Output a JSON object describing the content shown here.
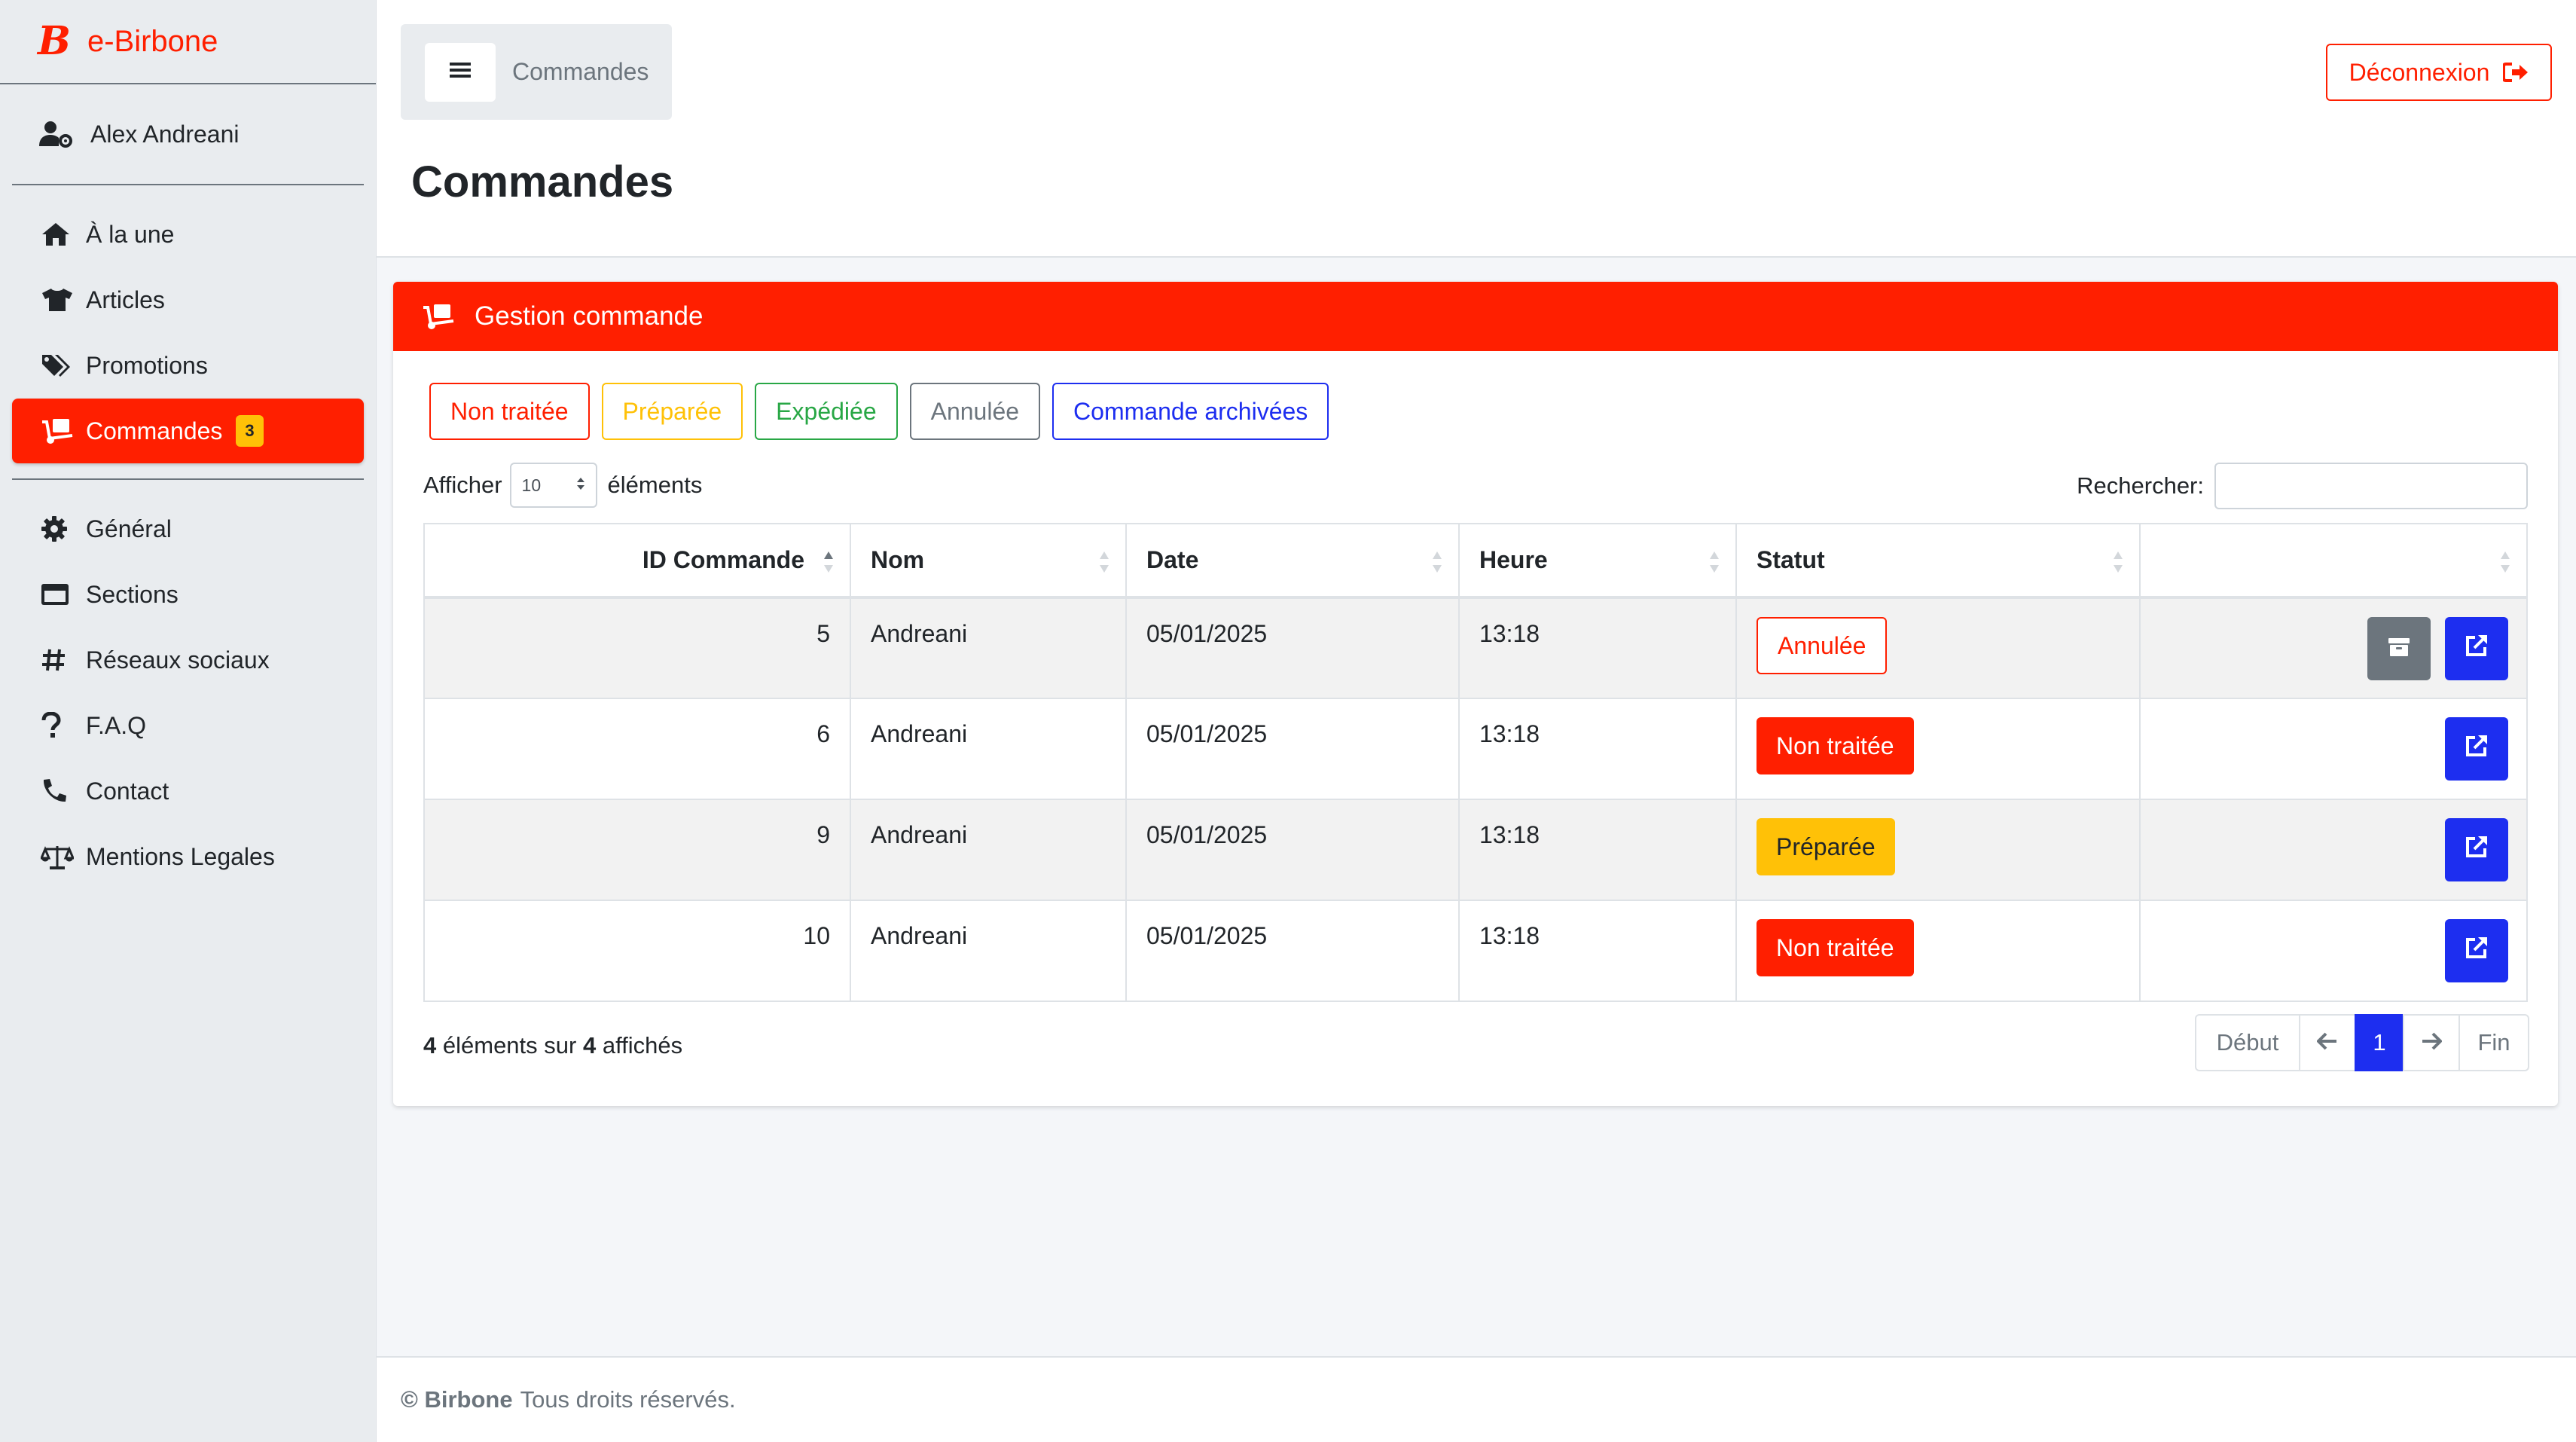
{
  "brand": {
    "logo_letter": "B",
    "name": "e-Birbone"
  },
  "user": {
    "name": "Alex Andreani"
  },
  "sidebar": {
    "items": [
      {
        "label": "À la une",
        "icon": "home-icon"
      },
      {
        "label": "Articles",
        "icon": "tshirt-icon"
      },
      {
        "label": "Promotions",
        "icon": "tags-icon"
      },
      {
        "label": "Commandes",
        "icon": "dolly-icon",
        "badge": "3",
        "active": true
      }
    ],
    "items2": [
      {
        "label": "Général",
        "icon": "gear-icon"
      },
      {
        "label": "Sections",
        "icon": "window-icon"
      },
      {
        "label": "Réseaux sociaux",
        "icon": "hashtag-icon"
      },
      {
        "label": "F.A.Q",
        "icon": "question-icon"
      },
      {
        "label": "Contact",
        "icon": "phone-icon"
      },
      {
        "label": "Mentions Legales",
        "icon": "scale-icon"
      }
    ]
  },
  "header": {
    "breadcrumb": "Commandes",
    "logout_label": "Déconnexion",
    "page_title": "Commandes"
  },
  "card": {
    "title": "Gestion commande",
    "filters": [
      "Non traitée",
      "Préparée",
      "Expédiée",
      "Annulée",
      "Commande archivées"
    ],
    "length_prefix": "Afficher",
    "length_value": "10",
    "length_suffix": "éléments",
    "search_label": "Rechercher:",
    "search_value": ""
  },
  "table": {
    "columns": [
      "ID Commande",
      "Nom",
      "Date",
      "Heure",
      "Statut",
      ""
    ],
    "rows": [
      {
        "id": "5",
        "nom": "Andreani",
        "date": "05/01/2025",
        "heure": "13:18",
        "statut": "Annulée",
        "style": "outline-red",
        "archive": true
      },
      {
        "id": "6",
        "nom": "Andreani",
        "date": "05/01/2025",
        "heure": "13:18",
        "statut": "Non traitée",
        "style": "red",
        "archive": false
      },
      {
        "id": "9",
        "nom": "Andreani",
        "date": "05/01/2025",
        "heure": "13:18",
        "statut": "Préparée",
        "style": "yellow",
        "archive": false
      },
      {
        "id": "10",
        "nom": "Andreani",
        "date": "05/01/2025",
        "heure": "13:18",
        "statut": "Non traitée",
        "style": "red",
        "archive": false
      }
    ]
  },
  "info": {
    "shown": "4",
    "middle": "éléments sur",
    "total": "4",
    "suffix": "affichés"
  },
  "pagination": {
    "first": "Début",
    "current": "1",
    "last": "Fin"
  },
  "footer": {
    "copyright": "© Birbone",
    "rights": "Tous droits réservés."
  },
  "colors": {
    "brand_red": "#ff1f00",
    "primary_blue": "#1d2ef0",
    "warning": "#ffc107",
    "success": "#28a745",
    "secondary": "#6c757d"
  }
}
